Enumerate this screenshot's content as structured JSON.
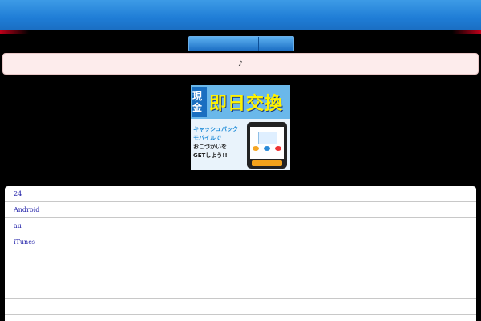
{
  "header": {
    "accent_color": "#c0001a",
    "bar_color": "#1f7dd6"
  },
  "nav": {
    "tab_count": 3
  },
  "notice": {
    "icon": "music-note-icon",
    "text": "♪"
  },
  "banner": {
    "side_kanji": "現金",
    "headline": "即日交換",
    "promo_line1": "キャッシュバック",
    "promo_line2": "モバイルで",
    "promo_line3": "おこづかいを",
    "promo_line4": "GETしよう!!"
  },
  "list": {
    "items": [
      "24",
      "Android",
      "au",
      "iTunes",
      "",
      "",
      "",
      ""
    ]
  }
}
